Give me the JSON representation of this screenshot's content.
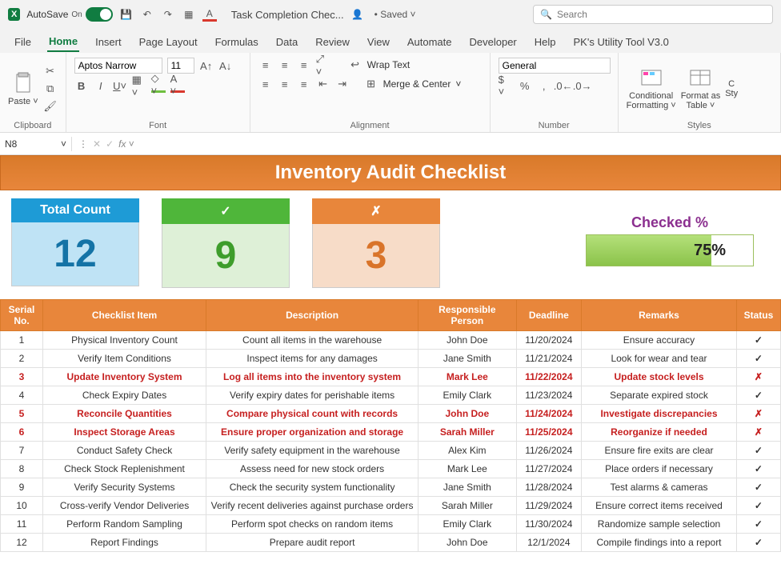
{
  "title": {
    "autosave": "AutoSave",
    "on": "On",
    "doc": "Task Completion Chec...",
    "saved": "Saved",
    "search_placeholder": "Search"
  },
  "tabs": [
    "File",
    "Home",
    "Insert",
    "Page Layout",
    "Formulas",
    "Data",
    "Review",
    "View",
    "Automate",
    "Developer",
    "Help",
    "PK's Utility Tool V3.0"
  ],
  "ribbon": {
    "clipboard": "Clipboard",
    "paste": "Paste",
    "font": "Font",
    "font_name": "Aptos Narrow",
    "font_size": "11",
    "alignment": "Alignment",
    "wrap": "Wrap Text",
    "merge": "Merge & Center",
    "number": "Number",
    "general": "General",
    "styles": "Styles",
    "cond": "Conditional\nFormatting",
    "formatas": "Format as\nTable",
    "cell": "C\nSty"
  },
  "namebox": "N8",
  "banner": "Inventory Audit Checklist",
  "cards": {
    "total_label": "Total Count",
    "total_value": "12",
    "pass_symbol": "✓",
    "pass_value": "9",
    "fail_symbol": "✗",
    "fail_value": "3",
    "checked_label": "Checked %",
    "checked_value": "75%",
    "checked_fill": "75%"
  },
  "headers": [
    "Serial No.",
    "Checklist Item",
    "Description",
    "Responsible Person",
    "Deadline",
    "Remarks",
    "Status"
  ],
  "rows": [
    {
      "n": "1",
      "item": "Physical Inventory Count",
      "desc": "Count all items in the warehouse",
      "resp": "John Doe",
      "dead": "11/20/2024",
      "rem": "Ensure accuracy",
      "status": "pass",
      "red": false
    },
    {
      "n": "2",
      "item": "Verify Item Conditions",
      "desc": "Inspect items for any damages",
      "resp": "Jane Smith",
      "dead": "11/21/2024",
      "rem": "Look for wear and tear",
      "status": "pass",
      "red": false
    },
    {
      "n": "3",
      "item": "Update Inventory System",
      "desc": "Log all items into the inventory system",
      "resp": "Mark Lee",
      "dead": "11/22/2024",
      "rem": "Update stock levels",
      "status": "fail",
      "red": true
    },
    {
      "n": "4",
      "item": "Check Expiry Dates",
      "desc": "Verify expiry dates for perishable items",
      "resp": "Emily Clark",
      "dead": "11/23/2024",
      "rem": "Separate expired stock",
      "status": "pass",
      "red": false
    },
    {
      "n": "5",
      "item": "Reconcile Quantities",
      "desc": "Compare physical count with records",
      "resp": "John Doe",
      "dead": "11/24/2024",
      "rem": "Investigate discrepancies",
      "status": "fail",
      "red": true
    },
    {
      "n": "6",
      "item": "Inspect Storage Areas",
      "desc": "Ensure proper organization and storage",
      "resp": "Sarah Miller",
      "dead": "11/25/2024",
      "rem": "Reorganize if needed",
      "status": "fail",
      "red": true
    },
    {
      "n": "7",
      "item": "Conduct Safety Check",
      "desc": "Verify safety equipment in the warehouse",
      "resp": "Alex Kim",
      "dead": "11/26/2024",
      "rem": "Ensure fire exits are clear",
      "status": "pass",
      "red": false
    },
    {
      "n": "8",
      "item": "Check Stock Replenishment",
      "desc": "Assess need for new stock orders",
      "resp": "Mark Lee",
      "dead": "11/27/2024",
      "rem": "Place orders if necessary",
      "status": "pass",
      "red": false
    },
    {
      "n": "9",
      "item": "Verify Security Systems",
      "desc": "Check the security system functionality",
      "resp": "Jane Smith",
      "dead": "11/28/2024",
      "rem": "Test alarms & cameras",
      "status": "pass",
      "red": false
    },
    {
      "n": "10",
      "item": "Cross-verify Vendor Deliveries",
      "desc": "Verify recent deliveries against purchase orders",
      "resp": "Sarah Miller",
      "dead": "11/29/2024",
      "rem": "Ensure correct items received",
      "status": "pass",
      "red": false
    },
    {
      "n": "11",
      "item": "Perform Random Sampling",
      "desc": "Perform spot checks on random items",
      "resp": "Emily Clark",
      "dead": "11/30/2024",
      "rem": "Randomize sample selection",
      "status": "pass",
      "red": false
    },
    {
      "n": "12",
      "item": "Report Findings",
      "desc": "Prepare audit report",
      "resp": "John Doe",
      "dead": "12/1/2024",
      "rem": "Compile findings into a report",
      "status": "pass",
      "red": false
    }
  ],
  "chart_data": {
    "type": "table",
    "title": "Inventory Audit Checklist",
    "summary": {
      "total": 12,
      "pass": 9,
      "fail": 3,
      "checked_pct": 75
    }
  }
}
